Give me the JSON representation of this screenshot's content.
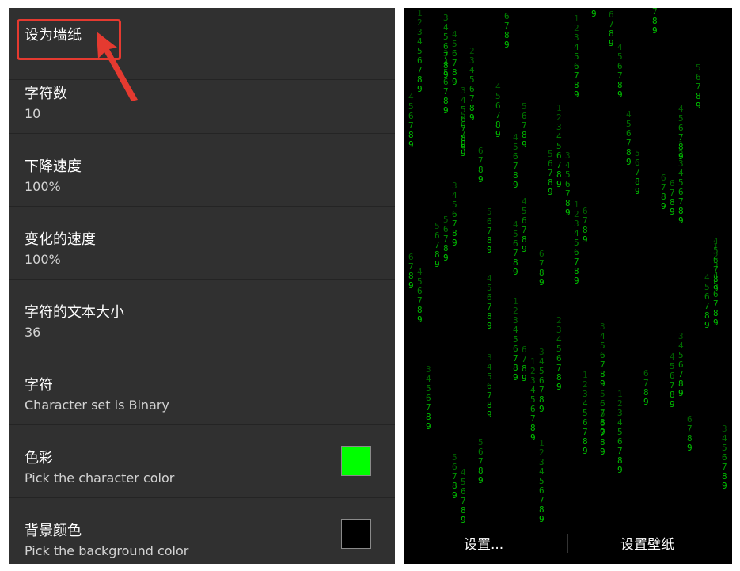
{
  "settings": {
    "set_wallpaper": "设为墙纸",
    "rows": [
      {
        "title": "字符数",
        "subtitle": "10"
      },
      {
        "title": "下降速度",
        "subtitle": "100%"
      },
      {
        "title": "变化的速度",
        "subtitle": "100%"
      },
      {
        "title": "字符的文本大小",
        "subtitle": "36"
      },
      {
        "title": "字符",
        "subtitle": "Character set is Binary"
      },
      {
        "title": "色彩",
        "subtitle": "Pick the character color"
      },
      {
        "title": "背景颜色",
        "subtitle": "Pick the background color"
      }
    ],
    "character_color": "#00ff00",
    "background_color": "#000000",
    "highlight_color": "#e53a30"
  },
  "preview": {
    "settings_button": "设置...",
    "set_wallpaper_button": "设置壁纸",
    "rain_color": "#00c800"
  }
}
